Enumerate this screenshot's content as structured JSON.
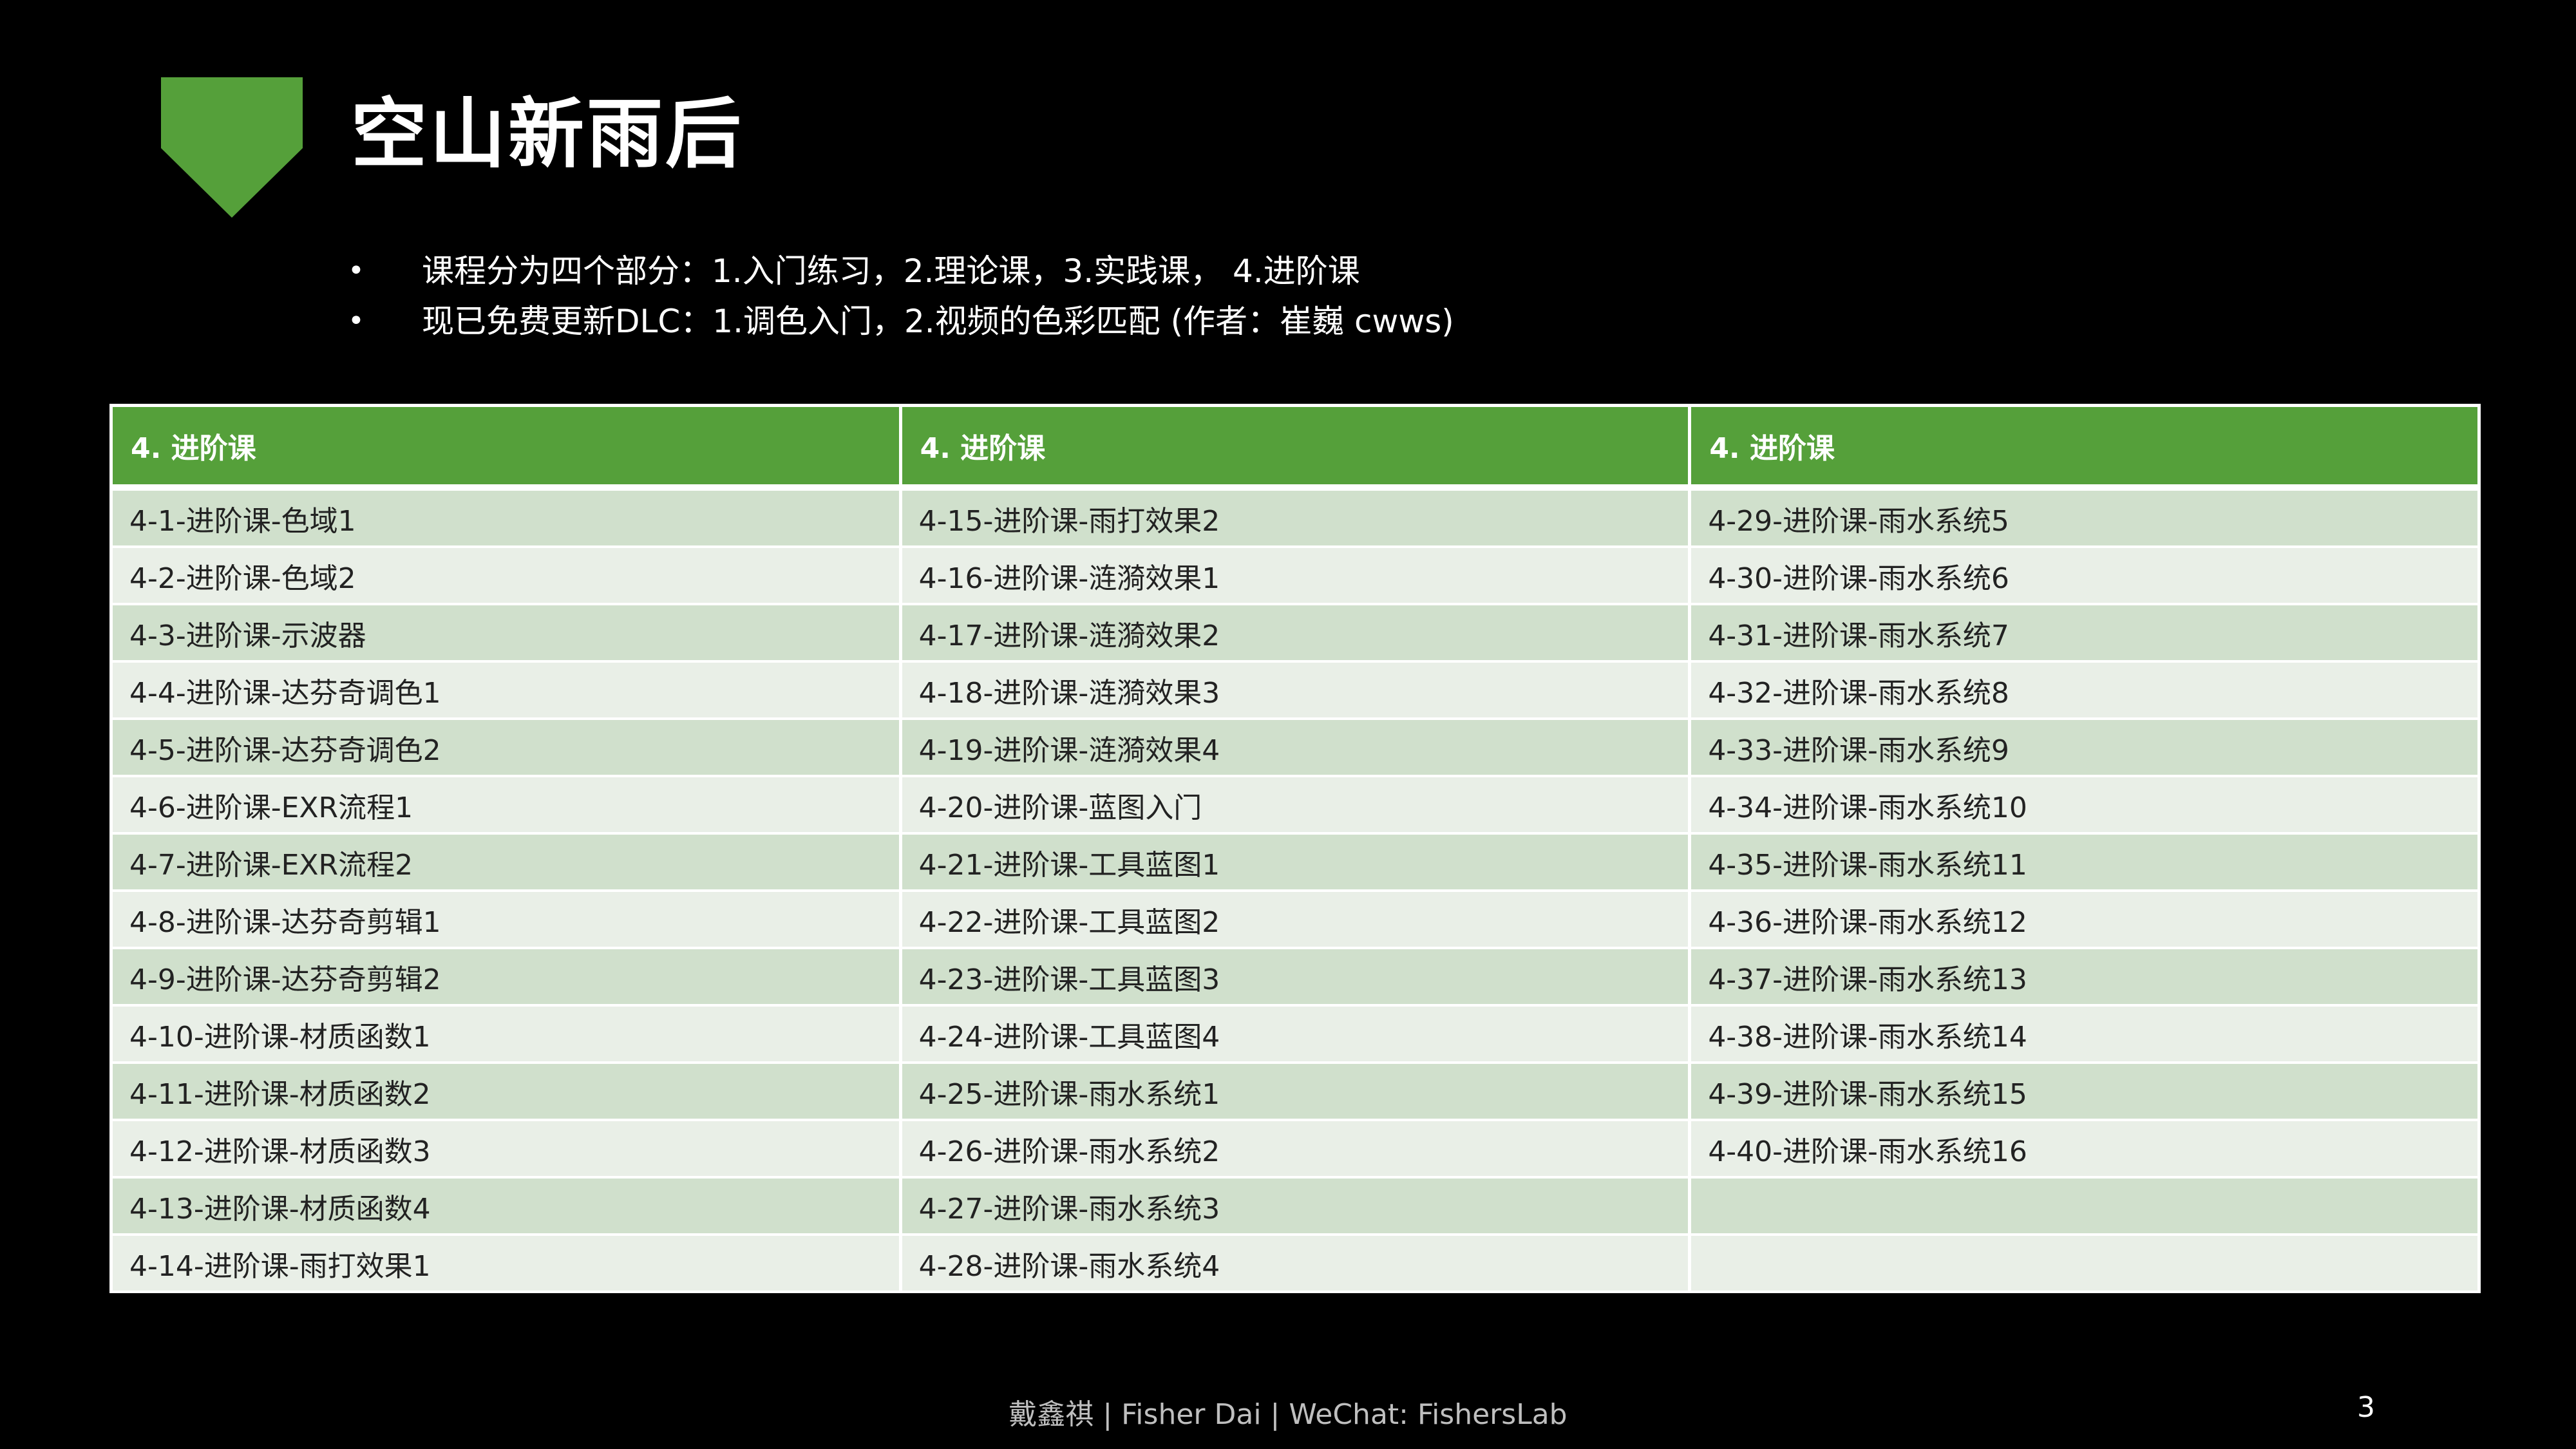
{
  "slide": {
    "title": "空山新雨后",
    "bullets": [
      "课程分为四个部分：1.入门练习，2.理论课，3.实践课， 4.进阶课",
      "现已免费更新DLC：1.调色入门，2.视频的色彩匹配 (作者：崔巍 cwws)"
    ],
    "bullet_glyph": "•",
    "accent_color": "#55a03a",
    "footer": "戴鑫祺 | Fisher Dai | WeChat: FishersLab",
    "page_number": "3"
  },
  "table": {
    "headers": [
      "4. 进阶课",
      "4. 进阶课",
      "4. 进阶课"
    ],
    "rows": [
      [
        "4-1-进阶课-色域1",
        "4-15-进阶课-雨打效果2",
        "4-29-进阶课-雨水系统5"
      ],
      [
        "4-2-进阶课-色域2",
        "4-16-进阶课-涟漪效果1",
        "4-30-进阶课-雨水系统6"
      ],
      [
        "4-3-进阶课-示波器",
        "4-17-进阶课-涟漪效果2",
        "4-31-进阶课-雨水系统7"
      ],
      [
        "4-4-进阶课-达芬奇调色1",
        "4-18-进阶课-涟漪效果3",
        "4-32-进阶课-雨水系统8"
      ],
      [
        "4-5-进阶课-达芬奇调色2",
        "4-19-进阶课-涟漪效果4",
        "4-33-进阶课-雨水系统9"
      ],
      [
        "4-6-进阶课-EXR流程1",
        "4-20-进阶课-蓝图入门",
        "4-34-进阶课-雨水系统10"
      ],
      [
        "4-7-进阶课-EXR流程2",
        "4-21-进阶课-工具蓝图1",
        "4-35-进阶课-雨水系统11"
      ],
      [
        "4-8-进阶课-达芬奇剪辑1",
        "4-22-进阶课-工具蓝图2",
        "4-36-进阶课-雨水系统12"
      ],
      [
        "4-9-进阶课-达芬奇剪辑2",
        "4-23-进阶课-工具蓝图3",
        "4-37-进阶课-雨水系统13"
      ],
      [
        "4-10-进阶课-材质函数1",
        "4-24-进阶课-工具蓝图4",
        "4-38-进阶课-雨水系统14"
      ],
      [
        "4-11-进阶课-材质函数2",
        "4-25-进阶课-雨水系统1",
        "4-39-进阶课-雨水系统15"
      ],
      [
        "4-12-进阶课-材质函数3",
        "4-26-进阶课-雨水系统2",
        "4-40-进阶课-雨水系统16"
      ],
      [
        "4-13-进阶课-材质函数4",
        "4-27-进阶课-雨水系统3",
        ""
      ],
      [
        "4-14-进阶课-雨打效果1",
        "4-28-进阶课-雨水系统4",
        ""
      ]
    ]
  }
}
